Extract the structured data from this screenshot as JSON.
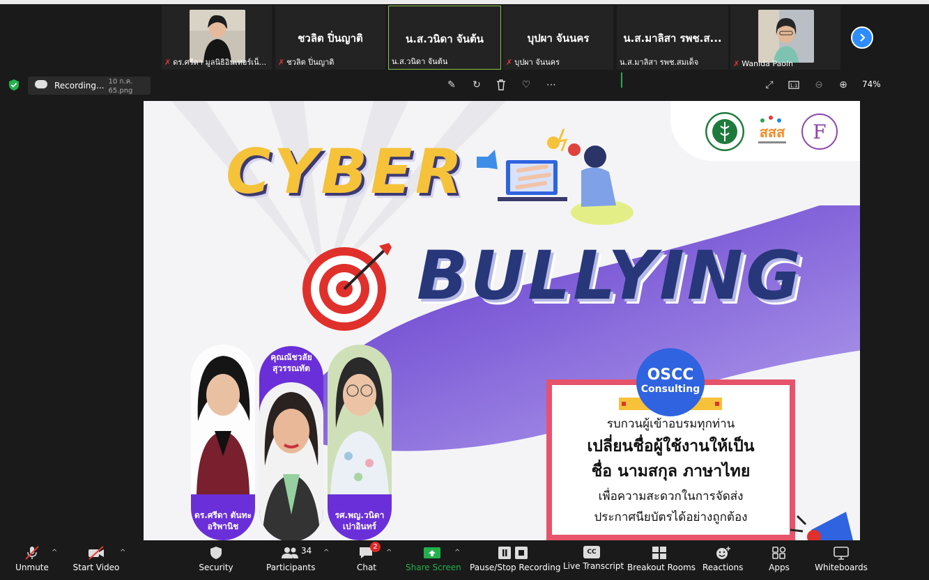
{
  "participants": [
    {
      "display": "",
      "name": "ดร.ศรีดา มูลนิธิอินเทอร์เน็...",
      "muted": true,
      "has_photo": true
    },
    {
      "display": "ชวลิต ปิ่นญาติ",
      "name": "ชวลิต ปิ่นญาติ",
      "muted": true,
      "has_photo": false
    },
    {
      "display": "น.ส.วนิดา จันต้น",
      "name": "น.ส.วนิดา จันต้น",
      "muted": false,
      "has_photo": false,
      "active": true
    },
    {
      "display": "บุปผา จันนคร",
      "name": "บุปผา จันนคร",
      "muted": true,
      "has_photo": false
    },
    {
      "display": "น.ส.มาลิสา รพช.ส...",
      "name": "น.ส.มาลิสา รพช.สมเด็จ",
      "muted": false,
      "has_photo": false
    },
    {
      "display": "",
      "name": "Wanida Paoin",
      "muted": true,
      "has_photo": true
    }
  ],
  "share_bar": {
    "recording_label": "Recording...",
    "file_name": "10 ก.ค. 65.png",
    "zoom_level": "74%"
  },
  "slide": {
    "title_line1": "CYBER",
    "title_line2": "BULLYING",
    "speaker_left": "ดร.ศรีดา ตันทะอริพานิช",
    "speaker_mid": "คุณณัชวลัย สุวรรณทัต",
    "speaker_right": "รศ.พญ.วนิดา เปาอินทร์",
    "badge_line1": "OSCC",
    "badge_line2": "Consulting",
    "notice_line1": "รบกวนผู้เข้าอบรมทุกท่าน",
    "notice_line2": "เปลี่ยนชื่อผู้ใช้งานให้เป็น",
    "notice_line3": "ชื่อ นามสกุล ภาษาไทย",
    "notice_line4": "เพื่อความสะดวกในการจัดส่ง",
    "notice_line5": "ประกาศนียบัตรได้อย่างถูกต้อง"
  },
  "toolbar": {
    "unmute": "Unmute",
    "start_video": "Start Video",
    "security": "Security",
    "participants": "Participants",
    "participants_count": "34",
    "chat": "Chat",
    "chat_badge": "2",
    "share_screen": "Share Screen",
    "pause_recording": "Pause/Stop Recording",
    "live_transcript": "Live Transcript",
    "live_transcript_icon": "CC",
    "breakout_rooms": "Breakout Rooms",
    "reactions": "Reactions",
    "apps": "Apps",
    "whiteboards": "Whiteboards"
  },
  "colors": {
    "zoom_blue": "#2d8cff",
    "share_green": "#22b14c",
    "active_border": "#8bc34a",
    "cyber_yellow": "#f5c23a",
    "bullying_navy": "#27377a",
    "purple": "#6a2fd8",
    "notice_red": "#e6536b"
  }
}
